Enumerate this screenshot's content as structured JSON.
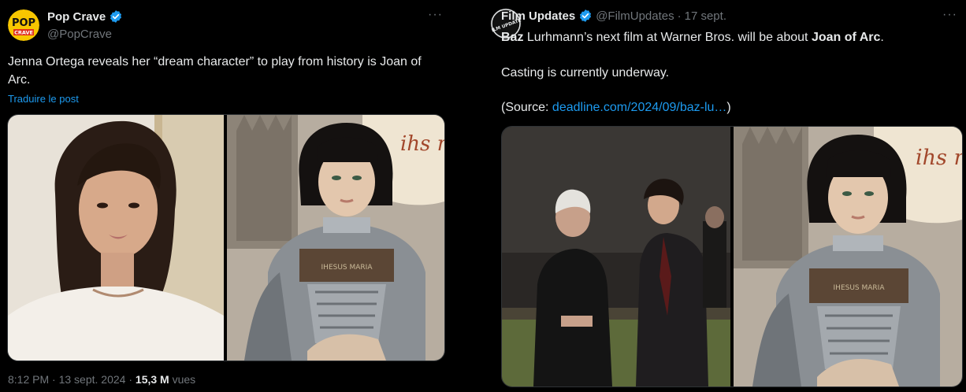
{
  "left_tweet": {
    "display_name": "Pop Crave",
    "handle": "@PopCrave",
    "avatar_text_top": "POP",
    "avatar_text_bottom": "CRAVE",
    "text": "Jenna Ortega reveals her “dream character” to play from history is Joan of Arc.",
    "translate_label": "Traduire le post",
    "time": "8:12 PM",
    "sep": " · ",
    "date": "13 sept. 2024",
    "views_count": "15,3 M",
    "views_label": " vues",
    "more_icon": "more-dots-icon"
  },
  "right_tweet": {
    "display_name": "Film Updates",
    "handle": "@FilmUpdates",
    "sep": " · ",
    "date": "17 sept.",
    "avatar_text": "FILM UPDATES",
    "line1_bold_a": "Baz",
    "line1_mid": " Lurhmann’s next film at Warner Bros. will be about ",
    "line1_bold_b": "Joan of Arc",
    "line1_end": ".",
    "line2": "Casting is currently underway.",
    "line3_start": "(Source: ",
    "line3_link": "deadline.com/2024/09/baz-lu…",
    "line3_end": ")",
    "more_icon": "more-dots-icon"
  },
  "painting_banner_text": "ihs mrie",
  "painting_armor_text": "IHESUS MARIA",
  "colors": {
    "background": "#000000",
    "text": "#e7e9ea",
    "muted": "#71767b",
    "link": "#1d9bf0",
    "verified": "#1d9bf0",
    "pop_crave_yellow": "#f7c600"
  }
}
